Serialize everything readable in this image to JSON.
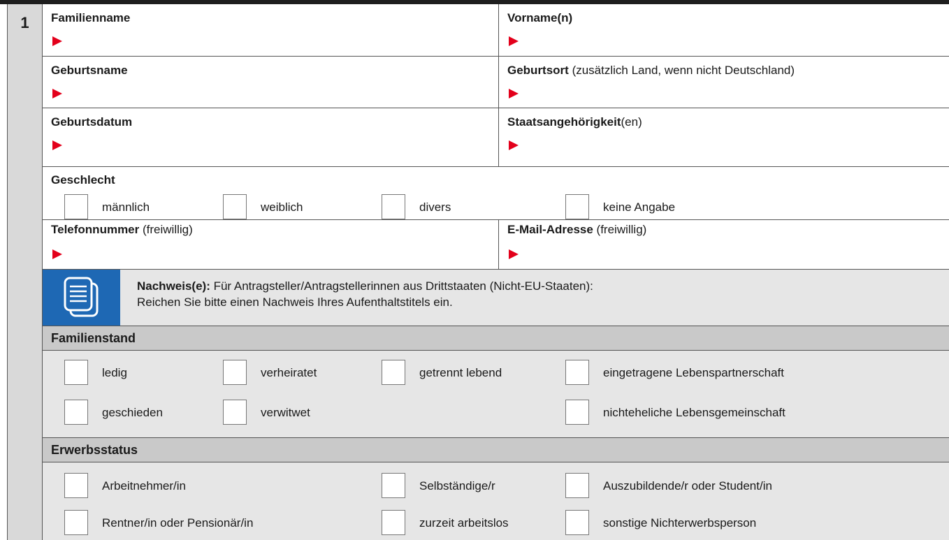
{
  "section": {
    "number": "1"
  },
  "fields": {
    "familienname": "Familienname",
    "vorname": "Vorname(n)",
    "geburtsname": "Geburtsname",
    "geburtsort_bold": "Geburtsort",
    "geburtsort_note": " (zusätzlich Land, wenn nicht Deutschland)",
    "geburtsdatum": "Geburtsdatum",
    "staatsangehoerigkeit_bold": "Staatsangehörigkeit",
    "staatsangehoerigkeit_suffix": "(en)",
    "telefon_bold": "Telefonnummer",
    "telefon_note": " (freiwillig)",
    "email_bold": "E-Mail-Adresse",
    "email_note": " (freiwillig)"
  },
  "geschlecht": {
    "label": "Geschlecht",
    "options": [
      "männlich",
      "weiblich",
      "divers",
      "keine Angabe"
    ]
  },
  "nachweis": {
    "bold": "Nachweis(e):",
    "line1": " Für Antragsteller/Antragstellerinnen aus Drittstaaten (Nicht-EU-Staaten):",
    "line2": "Reichen Sie bitte einen Nachweis Ihres Aufenthaltstitels ein."
  },
  "familienstand": {
    "label": "Familienstand",
    "options": [
      "ledig",
      "verheiratet",
      "getrennt lebend",
      "eingetragene Lebenspartnerschaft",
      "geschieden",
      "verwitwet",
      "nichteheliche Lebensgemeinschaft"
    ]
  },
  "erwerbsstatus": {
    "label": "Erwerbsstatus",
    "options": [
      "Arbeitnehmer/in",
      "Selbständige/r",
      "Auszubildende/r oder Student/in",
      "Rentner/in oder Pensionär/in",
      "zurzeit arbeitslos",
      "sonstige Nichterwerbsperson"
    ]
  },
  "colors": {
    "arrow": "#e3001b",
    "icon_bg": "#1e68b4",
    "section_bg": "#e6e6e6",
    "header_bg": "#c9c9c9"
  },
  "icons": {
    "arrow": "red-arrow-icon",
    "document": "document-icon"
  }
}
